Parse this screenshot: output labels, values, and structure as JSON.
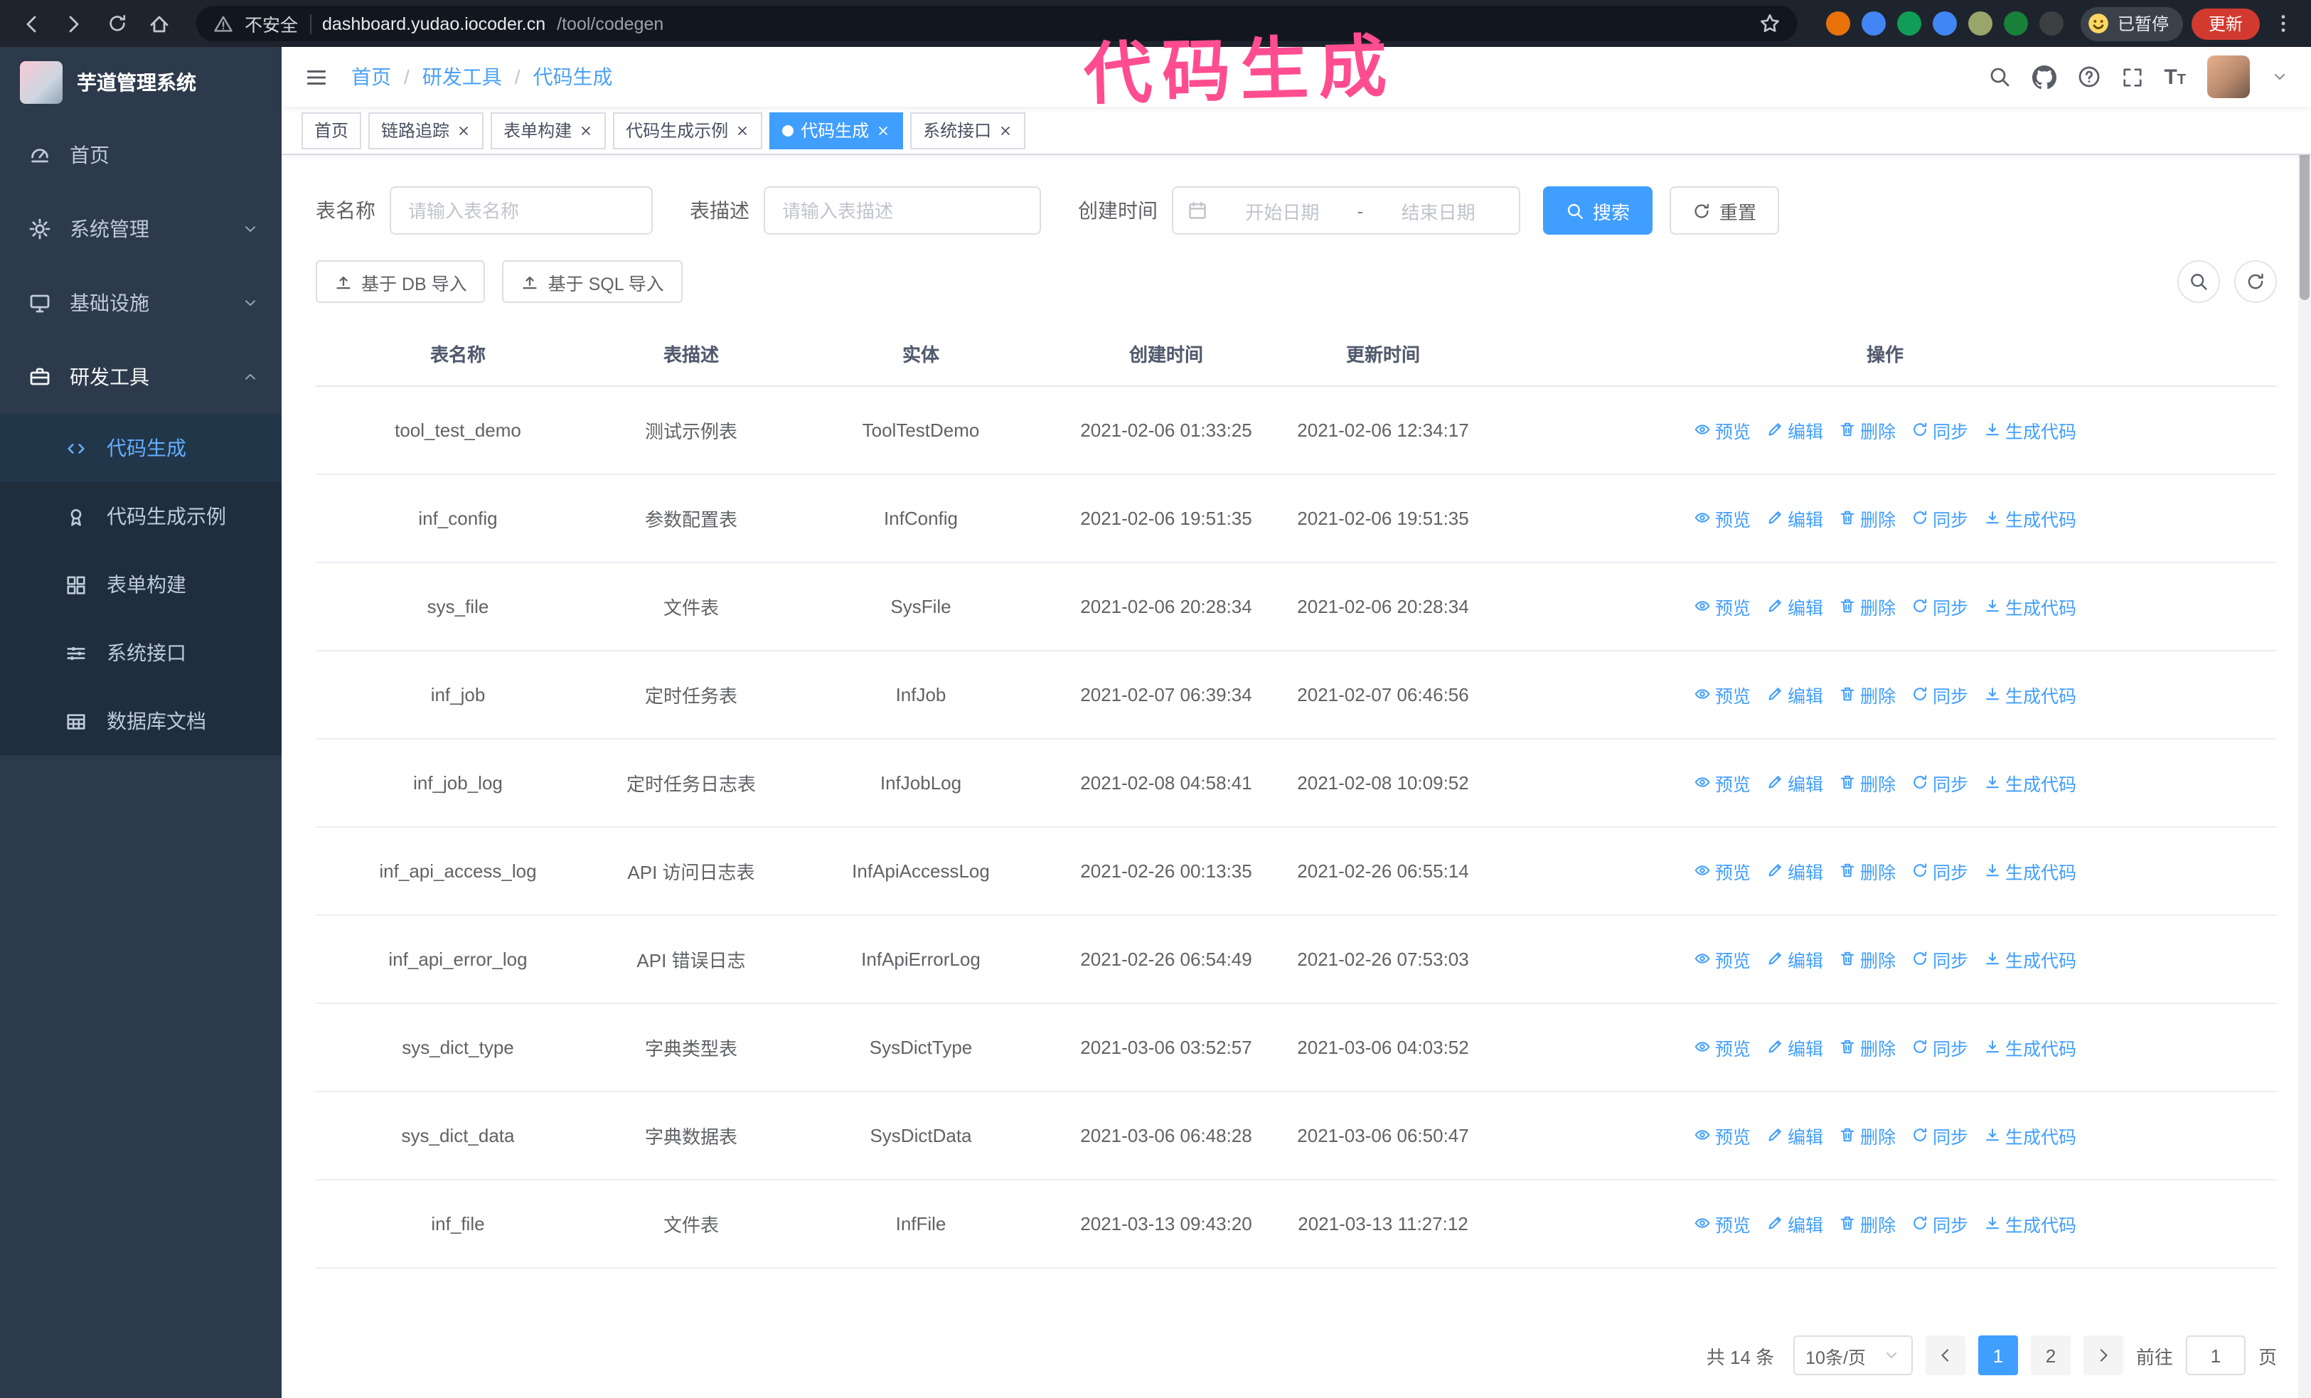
{
  "browser": {
    "security_label": "不安全",
    "url_host": "dashboard.yudao.iocoder.cn",
    "url_path": "/tool/codegen",
    "profile_status": "已暂停",
    "update_label": "更新",
    "extension_colors": [
      "#e8710a",
      "#4285f4",
      "#0f9d58",
      "#4285f4",
      "#9aa56a",
      "#188038",
      "#3c4043"
    ]
  },
  "annotation": {
    "text": "代码生成",
    "color": "#ff4d8f"
  },
  "sidebar": {
    "logo_title": "芋道管理系统",
    "menu": [
      {
        "key": "home",
        "label": "首页",
        "icon": "dashboard-icon"
      },
      {
        "key": "system",
        "label": "系统管理",
        "icon": "gear-icon",
        "chevron": "down"
      },
      {
        "key": "infra",
        "label": "基础设施",
        "icon": "monitor-icon",
        "chevron": "down"
      },
      {
        "key": "devtools",
        "label": "研发工具",
        "icon": "toolbox-icon",
        "chevron": "up",
        "active": true,
        "children": [
          {
            "key": "codegen",
            "label": "代码生成",
            "icon": "code-icon",
            "active": true
          },
          {
            "key": "codegen-example",
            "label": "代码生成示例",
            "icon": "medal-icon"
          },
          {
            "key": "form-builder",
            "label": "表单构建",
            "icon": "grid-icon"
          },
          {
            "key": "api",
            "label": "系统接口",
            "icon": "sliders-icon"
          },
          {
            "key": "db-doc",
            "label": "数据库文档",
            "icon": "table-icon"
          }
        ]
      }
    ]
  },
  "header": {
    "breadcrumb": [
      "首页",
      "研发工具",
      "代码生成"
    ]
  },
  "tabs": [
    {
      "label": "首页",
      "closable": false,
      "active": false
    },
    {
      "label": "链路追踪",
      "closable": true,
      "active": false
    },
    {
      "label": "表单构建",
      "closable": true,
      "active": false
    },
    {
      "label": "代码生成示例",
      "closable": true,
      "active": false
    },
    {
      "label": "代码生成",
      "closable": true,
      "active": true
    },
    {
      "label": "系统接口",
      "closable": true,
      "active": false
    }
  ],
  "filter": {
    "name_label": "表名称",
    "name_placeholder": "请输入表名称",
    "desc_label": "表描述",
    "desc_placeholder": "请输入表描述",
    "time_label": "创建时间",
    "start_placeholder": "开始日期",
    "range_separator": "-",
    "end_placeholder": "结束日期",
    "search_label": "搜索",
    "reset_label": "重置"
  },
  "toolbar": {
    "import_db_label": "基于 DB 导入",
    "import_sql_label": "基于 SQL 导入"
  },
  "table": {
    "columns": [
      "表名称",
      "表描述",
      "实体",
      "创建时间",
      "更新时间",
      "操作"
    ],
    "op_labels": [
      {
        "key": "preview",
        "label": "预览",
        "icon": "eye-icon"
      },
      {
        "key": "edit",
        "label": "编辑",
        "icon": "edit-icon"
      },
      {
        "key": "delete",
        "label": "删除",
        "icon": "trash-icon"
      },
      {
        "key": "sync",
        "label": "同步",
        "icon": "sync-icon"
      },
      {
        "key": "generate",
        "label": "生成代码",
        "icon": "download-icon"
      }
    ],
    "rows": [
      {
        "name": "tool_test_demo",
        "desc": "测试示例表",
        "entity": "ToolTestDemo",
        "created": "2021-02-06 01:33:25",
        "updated": "2021-02-06 12:34:17"
      },
      {
        "name": "inf_config",
        "desc": "参数配置表",
        "entity": "InfConfig",
        "created": "2021-02-06 19:51:35",
        "updated": "2021-02-06 19:51:35"
      },
      {
        "name": "sys_file",
        "desc": "文件表",
        "entity": "SysFile",
        "created": "2021-02-06 20:28:34",
        "updated": "2021-02-06 20:28:34"
      },
      {
        "name": "inf_job",
        "desc": "定时任务表",
        "entity": "InfJob",
        "created": "2021-02-07 06:39:34",
        "updated": "2021-02-07 06:46:56"
      },
      {
        "name": "inf_job_log",
        "desc": "定时任务日志表",
        "entity": "InfJobLog",
        "created": "2021-02-08 04:58:41",
        "updated": "2021-02-08 10:09:52"
      },
      {
        "name": "inf_api_access_log",
        "desc": "API 访问日志表",
        "entity": "InfApiAccessLog",
        "created": "2021-02-26 00:13:35",
        "updated": "2021-02-26 06:55:14"
      },
      {
        "name": "inf_api_error_log",
        "desc": "API 错误日志",
        "entity": "InfApiErrorLog",
        "created": "2021-02-26 06:54:49",
        "updated": "2021-02-26 07:53:03"
      },
      {
        "name": "sys_dict_type",
        "desc": "字典类型表",
        "entity": "SysDictType",
        "created": "2021-03-06 03:52:57",
        "updated": "2021-03-06 04:03:52"
      },
      {
        "name": "sys_dict_data",
        "desc": "字典数据表",
        "entity": "SysDictData",
        "created": "2021-03-06 06:48:28",
        "updated": "2021-03-06 06:50:47"
      },
      {
        "name": "inf_file",
        "desc": "文件表",
        "entity": "InfFile",
        "created": "2021-03-13 09:43:20",
        "updated": "2021-03-13 11:27:12"
      }
    ]
  },
  "pagination": {
    "total": "共 14 条",
    "page_size": "10条/页",
    "pages": [
      "1",
      "2"
    ],
    "current": "1",
    "goto_label": "前往",
    "goto_value": "1",
    "goto_suffix": "页"
  }
}
